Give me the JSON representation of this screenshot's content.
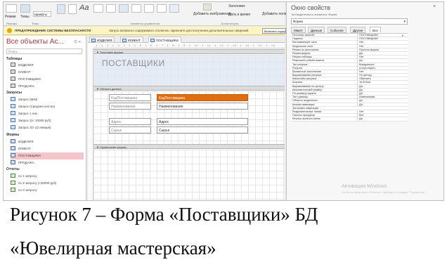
{
  "ribbon": {
    "row1": [
      {
        "label": "Режим",
        "name": "view-mode-label"
      },
      {
        "label": "Темы",
        "name": "themes-label"
      },
      {
        "label": "Шрифты",
        "name": "fonts-label"
      },
      {
        "label": "Добавить изображение",
        "name": "insert-image-label"
      },
      {
        "label": "Заголовок",
        "name": "title-label"
      },
      {
        "label": "Дата и время",
        "name": "date-time-label"
      },
      {
        "label": "Добавить поля",
        "name": "add-fields-label"
      }
    ],
    "groups": [
      "Режимы",
      "Темы",
      "Элементы управления",
      "Колонтитулы"
    ]
  },
  "security_bar": {
    "title": "ПРЕДУПРЕЖДЕНИЕ СИСТЕМЫ БЕЗОПАСНОСТИ",
    "message": "Запуск активного содержимого отключен. Щелкните для получения дополнительных сведений.",
    "button": "Включить содержимое"
  },
  "nav": {
    "title": "Все объекты Ac...",
    "search_placeholder": "Поиск...",
    "sections": [
      {
        "name": "Таблицы",
        "items": [
          {
            "label": "ИЗДЕЛИЯ",
            "kind": "table"
          },
          {
            "label": "КЛИЕНТ",
            "kind": "table"
          },
          {
            "label": "ПОСТАВЩИКИ",
            "kind": "table"
          },
          {
            "label": "ПРОДАЖА",
            "kind": "table"
          }
        ]
      },
      {
        "name": "Запросы",
        "items": [
          {
            "label": "Запрос (MIN)",
            "kind": "query"
          },
          {
            "label": "Запрос (Среднее кол-во)",
            "kind": "query"
          },
          {
            "label": "Запрос 1 ник",
            "kind": "query"
          },
          {
            "label": "Запрос 2(< 10000 руб)",
            "kind": "query"
          },
          {
            "label": "Запрос 3(> 22 января)",
            "kind": "query"
          }
        ]
      },
      {
        "name": "Формы",
        "items": [
          {
            "label": "ИЗДЕЛИЯ",
            "kind": "form"
          },
          {
            "label": "КЛИЕНТ",
            "kind": "form"
          },
          {
            "label": "ПОСТАВЩИКИ",
            "kind": "form",
            "selected": true
          },
          {
            "label": "ПРОДАЖА",
            "kind": "form"
          }
        ]
      },
      {
        "name": "Отчеты",
        "items": [
          {
            "label": "по 1 запросу",
            "kind": "report"
          },
          {
            "label": "по 2 запросу (<10000 руб)",
            "kind": "report"
          },
          {
            "label": "по 3 запросу",
            "kind": "report"
          }
        ]
      }
    ]
  },
  "doc": {
    "tabs": [
      "ИЗДЕЛИЯ",
      "КЛИЕНТ",
      "ПОСТАВЩИКИ"
    ],
    "active_tab": "ПОСТАВЩИКИ",
    "ruler": "· 1 · 1 · 2 · 1 · 3 · 1 · 4 · 1 · 5 · 1 · 6 · 1 · 7 · 1 · 8 · 1 · 9 · 1 · 10 · 1 · 11 · 1 · 12 · 1 · 13 · 1 · 14 · 1 · 15 · 1 · 16",
    "header_band": "Заголовок формы",
    "form_title": "ПОСТАВЩИКИ",
    "detail_band": "Область данных",
    "footer_band": "Примечание формы",
    "fields": [
      {
        "label": "КодПоставщика",
        "control": "КодПоставщика",
        "highlight": true
      },
      {
        "label": "Наименование",
        "control": "Наименование",
        "highlight": false
      },
      {
        "label": "Адрес",
        "control": "Адрес",
        "highlight": false
      },
      {
        "label": "Сырье",
        "control": "Сырье",
        "highlight": false
      }
    ]
  },
  "props": {
    "title": "Окно свойств",
    "subtitle": "Тип выделенного элемента: Форма",
    "selector": "Форма",
    "tabs": [
      "Макет",
      "Данные",
      "События",
      "Другие",
      "Все"
    ],
    "active_tab": "Все",
    "rows": [
      [
        "Источник записей",
        "ПОСТАВЩИКИ"
      ],
      [
        "Подпись",
        "ПОСТАВЩИКИ"
      ],
      [
        "Всплывающее окно",
        "Нет"
      ],
      [
        "Модальное окно",
        "Нет"
      ],
      [
        "Режим по умолчанию",
        "Простая форма"
      ],
      [
        "Режим формы",
        "Да"
      ],
      [
        "Режим таблицы",
        "Нет"
      ],
      [
        "Разрешить режим макета",
        "Да"
      ],
      [
        "Тип рисунка",
        "Внедренное"
      ],
      [
        "Рисунок",
        "(отсутствует)"
      ],
      [
        "Мозаичное заполнение",
        "Нет"
      ],
      [
        "Выравнивание рисунка",
        "По центру"
      ],
      [
        "Масштабы рисунка",
        "Обрезать"
      ],
      [
        "Ширина",
        "16,503см"
      ],
      [
        "Выравнивание по центру",
        "Да"
      ],
      [
        "Автоматический размер",
        "Да"
      ],
      [
        "По размеру экрана",
        "Да"
      ],
      [
        "Тип границы",
        "Изменяемая"
      ],
      [
        "Область выделения",
        "Да"
      ],
      [
        "Кнопки навигации",
        "Да"
      ],
      [
        "Заголовок навигации",
        ""
      ],
      [
        "Разделительные линии",
        "Нет"
      ],
      [
        "Полосы прокрутки",
        "Все"
      ],
      [
        "Кнопка оконного меню",
        "Да"
      ]
    ],
    "watermark_title": "Активация Windows",
    "watermark_sub": "Чтобы активировать Windows, перейдите в раздел \"Параметры\"."
  },
  "caption": {
    "line1": "Рисунок 7 – Форма «Поставщики» БД",
    "line2": "«Ювелирная мастерская»"
  }
}
